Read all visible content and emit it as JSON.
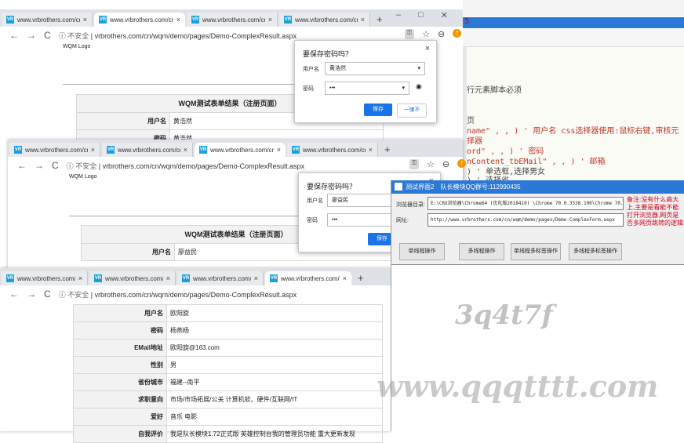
{
  "bg_window": {
    "tabs": [
      {
        "label": "www.vrbrothers.com/cn/",
        "close": "×"
      },
      {
        "label": "www.vrbrothers.com/cn/",
        "close": "×"
      },
      {
        "label": "www.vrbrothers.com/cn/",
        "close": "×"
      },
      {
        "label": "www.vrbrothers.com/cn/",
        "close": "×"
      }
    ],
    "new_tab": "+",
    "url": "vrbrothers.com/cn/wqm/demo/pages/Demo-ComplexResult.aspx",
    "security": "不安全",
    "logo_text": "WQM Logo",
    "form_title": "WQM测试表单结果（注册页面）",
    "rows": [
      {
        "label": "用户名",
        "value": "黄浩然"
      },
      {
        "label": "密码",
        "value": "黄浩然"
      }
    ],
    "pwd_dialog": {
      "title": "要保存密码吗？",
      "user_label": "用户名",
      "user_value": "黄浩然",
      "pass_label": "密码",
      "pass_value": "•••",
      "save": "保存",
      "never": "一律不",
      "close": "×"
    }
  },
  "mid_window": {
    "tabs": [
      {
        "label": "www.vrbrothers.com/cn/",
        "close": "×"
      },
      {
        "label": "www.vrbrothers.com/cn/",
        "close": "×"
      },
      {
        "label": "www.vrbrothers.com/cn/",
        "close": "×"
      },
      {
        "label": "www.vrbrothers.com/cn/",
        "close": "×"
      }
    ],
    "new_tab": "+",
    "url": "vrbrothers.com/cn/wqm/demo/pages/Demo-ComplexResult.aspx",
    "security": "不安全",
    "logo_text": "WQM Logo",
    "form_title": "WQM测试表单结果（注册页面）",
    "rows": [
      {
        "label": "用户名",
        "value": "廖益民"
      },
      {
        "label": "密码",
        "value": "廖益民"
      }
    ],
    "pwd_dialog": {
      "title": "要保存密码吗？",
      "user_label": "用户名",
      "user_value": "廖益民",
      "pass_label": "密码",
      "pass_value": "•••",
      "save": "保存",
      "close": "×"
    }
  },
  "front_window": {
    "tabs": [
      {
        "label": "www.vrbrothers.com/cn/",
        "close": "×"
      },
      {
        "label": "www.vrbrothers.com/cn/",
        "close": "×"
      },
      {
        "label": "www.vrbrothers.com/cn/",
        "close": "×"
      },
      {
        "label": "www.vrbrothers.com/cn/",
        "close": "×"
      }
    ],
    "new_tab": "+",
    "url": "vrbrothers.com/cn/wqm/demo/pages/Demo-ComplexResult.aspx",
    "security": "不安全",
    "rows": [
      {
        "label": "用户名",
        "value": "欧阳旋"
      },
      {
        "label": "密码",
        "value": "杨燕杨"
      },
      {
        "label": "EMail地址",
        "value": "欧阳旋@163.com"
      },
      {
        "label": "性别",
        "value": "男"
      },
      {
        "label": "省份城市",
        "value": "福建--南平"
      },
      {
        "label": "求职意向",
        "value": "市场/市场拓展/公关 计算机软、硬件/互联网/IT"
      },
      {
        "label": "爱好",
        "value": "音乐 电影"
      },
      {
        "label": "自我评价",
        "value": "我是队长模块1.72正式版 英雄控制台我的管理员功能 重大更新发现"
      }
    ]
  },
  "code_editor": {
    "top_char": "5",
    "lines": [
      "行元素脚本必须",
      "页",
      "name\" , , )  ' 用户名 css选择器使用:鼠标右键,审核元",
      "择器",
      "ord\" , , )  ' 密码",
      "nContent_tbEMail\" , , )  ' 邮箱",
      ")  ' 单选框,选择男女",
      ")  ' 选择省"
    ]
  },
  "winform": {
    "title": "测试界面2　队长模块QQ群号:112990435",
    "browser_dir_label": "浏览器目录:",
    "browser_dir_value": "E:\\CRX浏览器\\Chrome64 (优化版2018410) \\Chrome 70.0.3538.100\\Chrome 70.0.3",
    "url_label": "网址:",
    "url_value": "http://www.vrbrothers.com/cn/wqm/demo/pages/Demo-ComplexForm.aspx",
    "note": "备注:没有什么高大上,主要是看能不能打开浏览器,网页是否多网页跳转的逻辑",
    "buttons": [
      "单线程操作",
      "多线程操作",
      "单线程多标签操作",
      "多线程多标签操作"
    ]
  },
  "watermarks": {
    "a": "3q4t7f",
    "b": "www.qqqtttt.com"
  }
}
